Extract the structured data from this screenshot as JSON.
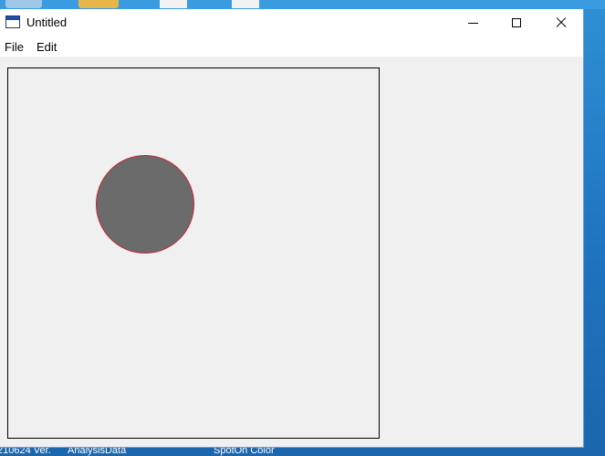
{
  "window": {
    "title": "Untitled",
    "controls": [
      "minimize",
      "maximize",
      "close"
    ]
  },
  "menu": {
    "items": [
      "File",
      "Edit"
    ]
  },
  "canvas": {
    "spot_fill": "#6b6b6b",
    "spot_outline": "#c0262b"
  },
  "desktop": {
    "labels": [
      "210624 Ver.",
      "AnalysisData",
      "SpotOn Color"
    ]
  }
}
